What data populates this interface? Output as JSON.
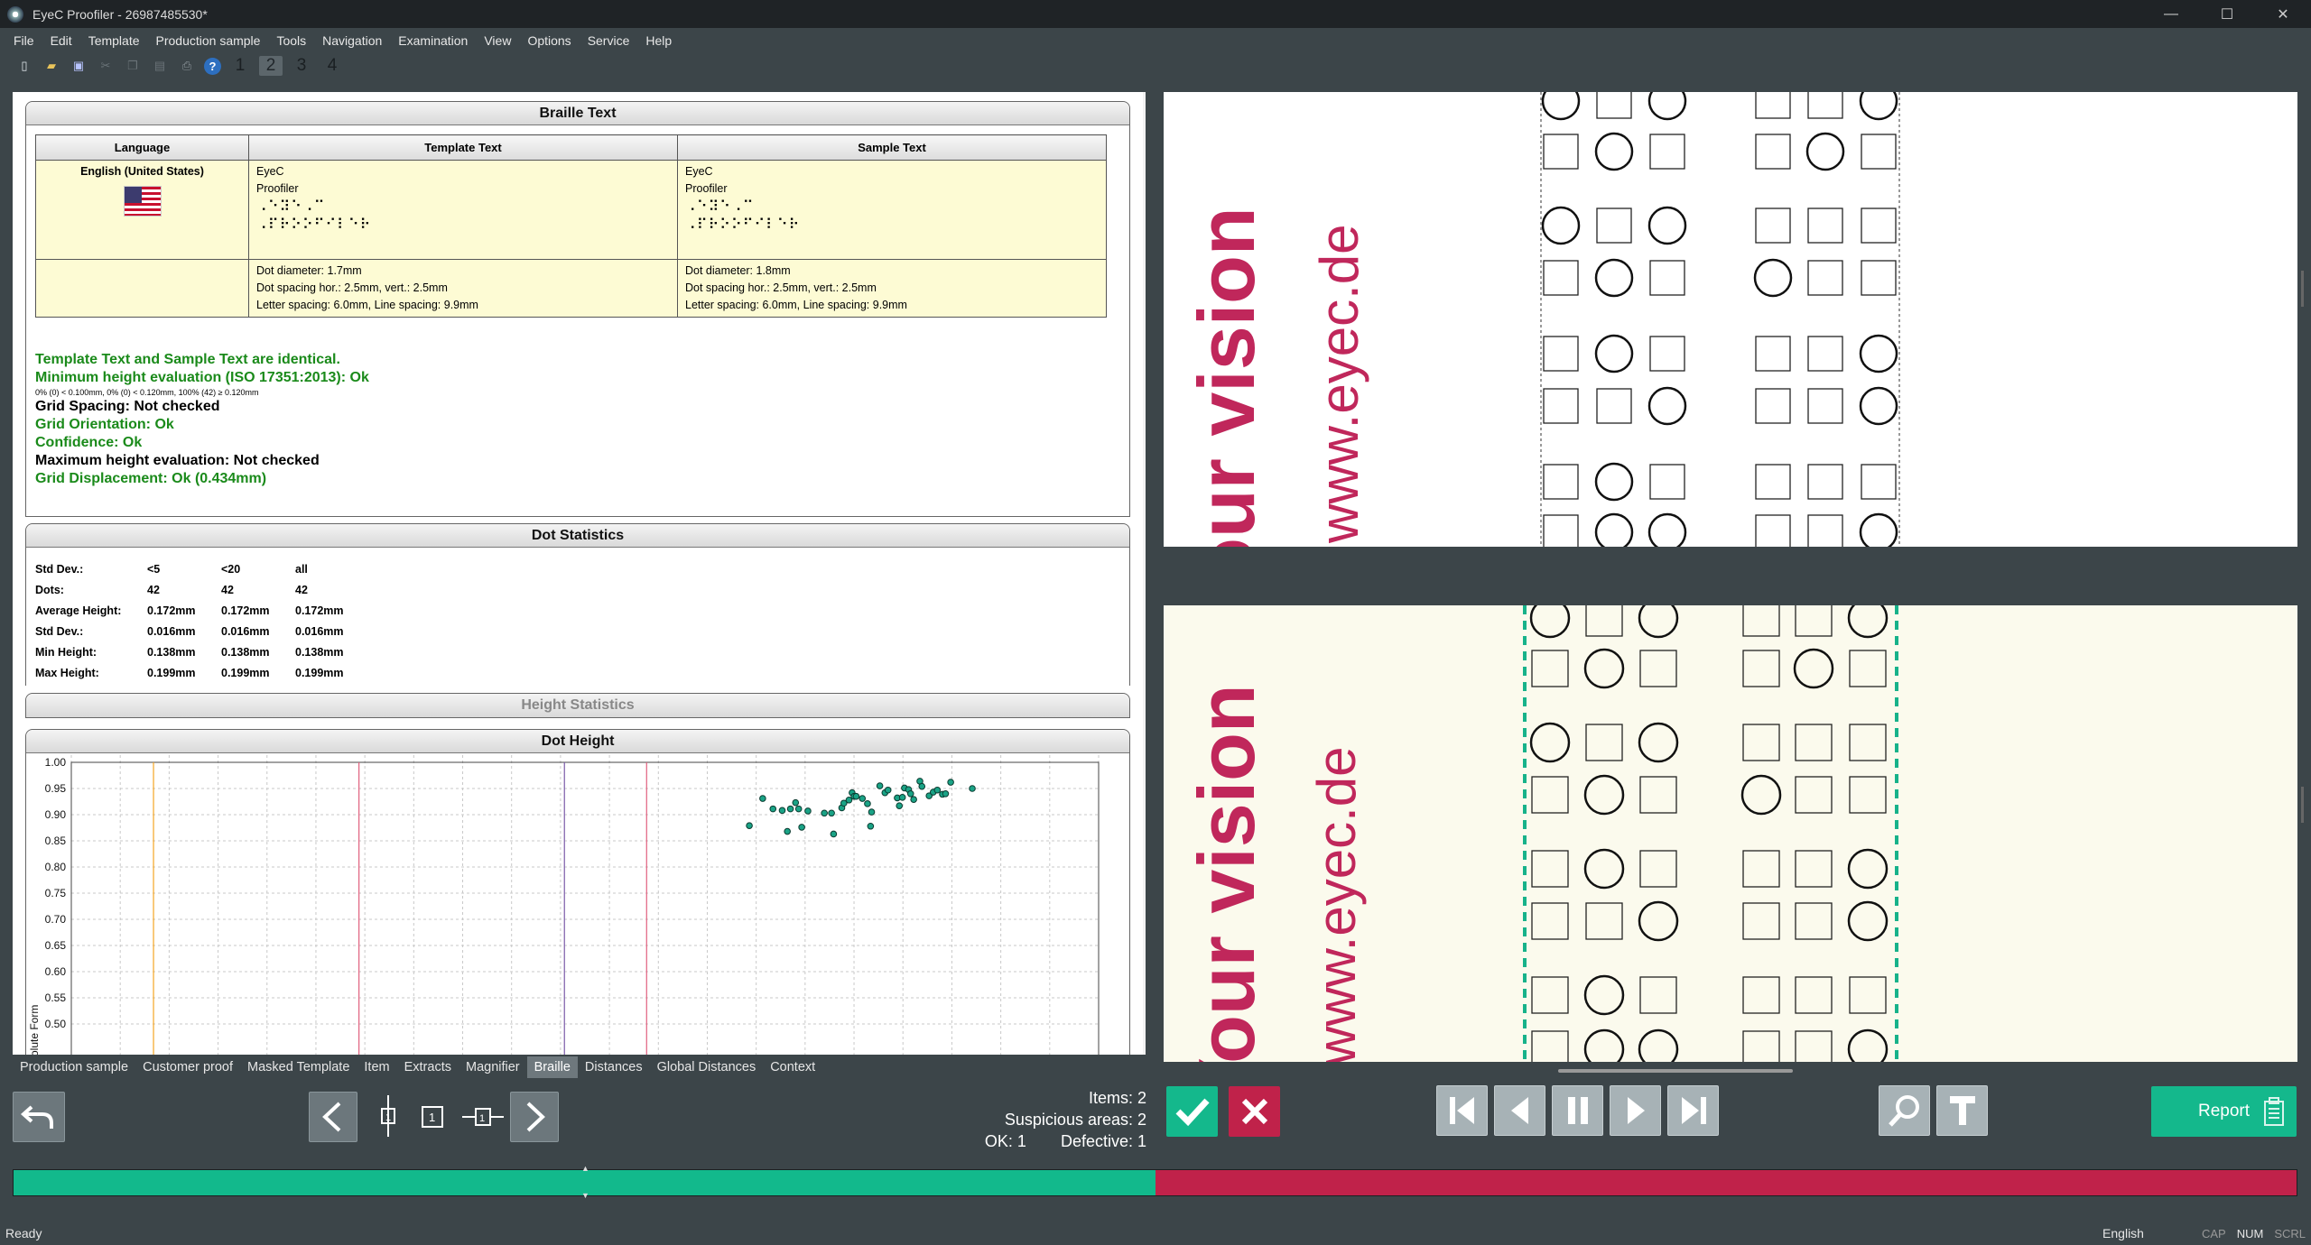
{
  "window": {
    "title": "EyeC Proofiler - 26987485530*"
  },
  "menu": [
    "File",
    "Edit",
    "Template",
    "Production sample",
    "Tools",
    "Navigation",
    "Examination",
    "View",
    "Options",
    "Service",
    "Help"
  ],
  "toolbar": {
    "pages": [
      "1",
      "2",
      "3",
      "4"
    ],
    "selected_page": "2"
  },
  "braille_section": {
    "title": "Braille Text",
    "headers": [
      "Language",
      "Template Text",
      "Sample Text"
    ],
    "language": "English (United States)",
    "template_text": [
      "EyeC",
      "Proofiler"
    ],
    "template_braille": [
      "⠠⠑⠽⠑⠠⠉",
      "⠠⠏⠗⠕⠕⠋⠊⠇⠑⠗"
    ],
    "sample_text": [
      "EyeC",
      "Proofiler"
    ],
    "sample_braille": [
      "⠠⠑⠽⠑⠠⠉",
      "⠠⠏⠗⠕⠕⠋⠊⠇⠑⠗"
    ],
    "template_params": [
      "Dot diameter: 1.7mm",
      "Dot spacing hor.: 2.5mm, vert.: 2.5mm",
      "Letter spacing: 6.0mm, Line spacing: 9.9mm"
    ],
    "sample_params": [
      "Dot diameter: 1.8mm",
      "Dot spacing hor.: 2.5mm, vert.: 2.5mm",
      "Letter spacing: 6.0mm, Line spacing: 9.9mm"
    ],
    "results": {
      "identical": "Template Text and Sample Text are identical.",
      "min_height": "Minimum height evaluation (ISO 17351:2013): Ok",
      "min_height_detail": "0% (0) < 0.100mm, 0% (0) < 0.120mm, 100% (42) ≥ 0.120mm",
      "grid_spacing": "Grid Spacing: Not checked",
      "grid_orientation": "Grid Orientation: Ok",
      "confidence": "Confidence: Ok",
      "max_height": "Maximum height evaluation: Not checked",
      "grid_displacement": "Grid Displacement: Ok (0.434mm)"
    }
  },
  "dot_statistics": {
    "title": "Dot Statistics",
    "rows": [
      [
        "Std Dev.:",
        "<5",
        "<20",
        "all"
      ],
      [
        "Dots:",
        "42",
        "42",
        "42"
      ],
      [
        "Average Height:",
        "0.172mm",
        "0.172mm",
        "0.172mm"
      ],
      [
        "Std Dev.:",
        "0.016mm",
        "0.016mm",
        "0.016mm"
      ],
      [
        "Min Height:",
        "0.138mm",
        "0.138mm",
        "0.138mm"
      ],
      [
        "Max Height:",
        "0.199mm",
        "0.199mm",
        "0.199mm"
      ]
    ]
  },
  "height_statistics": {
    "title": "Height Statistics"
  },
  "dot_height": {
    "title": "Dot Height",
    "ylabel_partial": "olute Form"
  },
  "chart_data": {
    "type": "scatter",
    "title": "Dot Height",
    "ylabel": "olute Form",
    "ylim": [
      0.5,
      1.0
    ],
    "yticks": [
      "1.00",
      "0.95",
      "0.90",
      "0.85",
      "0.80",
      "0.75",
      "0.70",
      "0.65",
      "0.60",
      "0.55",
      "0.50"
    ],
    "grid": true,
    "vertical_lines": [
      {
        "x": 0.08,
        "color": "#f5a623"
      },
      {
        "x": 0.28,
        "color": "#e0607e"
      },
      {
        "x": 0.48,
        "color": "#7a5aa8"
      },
      {
        "x": 0.56,
        "color": "#e0607e"
      }
    ],
    "points": [
      [
        0.66,
        0.879
      ],
      [
        0.673,
        0.931
      ],
      [
        0.683,
        0.911
      ],
      [
        0.692,
        0.908
      ],
      [
        0.697,
        0.868
      ],
      [
        0.7,
        0.911
      ],
      [
        0.705,
        0.923
      ],
      [
        0.708,
        0.911
      ],
      [
        0.711,
        0.876
      ],
      [
        0.717,
        0.907
      ],
      [
        0.733,
        0.903
      ],
      [
        0.74,
        0.903
      ],
      [
        0.742,
        0.863
      ],
      [
        0.75,
        0.913
      ],
      [
        0.752,
        0.922
      ],
      [
        0.757,
        0.928
      ],
      [
        0.76,
        0.942
      ],
      [
        0.762,
        0.935
      ],
      [
        0.764,
        0.935
      ],
      [
        0.77,
        0.931
      ],
      [
        0.775,
        0.921
      ],
      [
        0.778,
        0.878
      ],
      [
        0.779,
        0.905
      ],
      [
        0.787,
        0.955
      ],
      [
        0.792,
        0.942
      ],
      [
        0.795,
        0.947
      ],
      [
        0.804,
        0.932
      ],
      [
        0.806,
        0.917
      ],
      [
        0.809,
        0.933
      ],
      [
        0.811,
        0.951
      ],
      [
        0.815,
        0.948
      ],
      [
        0.817,
        0.94
      ],
      [
        0.82,
        0.929
      ],
      [
        0.826,
        0.964
      ],
      [
        0.828,
        0.954
      ],
      [
        0.835,
        0.936
      ],
      [
        0.839,
        0.943
      ],
      [
        0.843,
        0.947
      ],
      [
        0.848,
        0.939
      ],
      [
        0.851,
        0.94
      ],
      [
        0.856,
        0.962
      ],
      [
        0.877,
        0.95
      ]
    ]
  },
  "bottom_tabs": [
    "Production sample",
    "Customer proof",
    "Masked Template",
    "Item",
    "Extracts",
    "Magnifier",
    "Braille",
    "Distances",
    "Global Distances",
    "Context"
  ],
  "active_tab": "Braille",
  "counts": {
    "items": "Items: 2",
    "suspicious": "Suspicious areas: 2",
    "ok": "OK: 1",
    "defective": "Defective: 1"
  },
  "report": {
    "label": "Report"
  },
  "progress": {
    "ok_fraction": 0.5
  },
  "image_text": {
    "line1": "Your vision",
    "line2": "www.eyec.de"
  },
  "status": {
    "left": "Ready",
    "language": "English",
    "cap": "CAP",
    "num": "NUM",
    "scrl": "SCRL"
  },
  "colors": {
    "ok_green": "#12b98c",
    "defective_red": "#c0224a",
    "brand_magenta": "#c0275b",
    "dashed_teal": "#17b28a"
  }
}
